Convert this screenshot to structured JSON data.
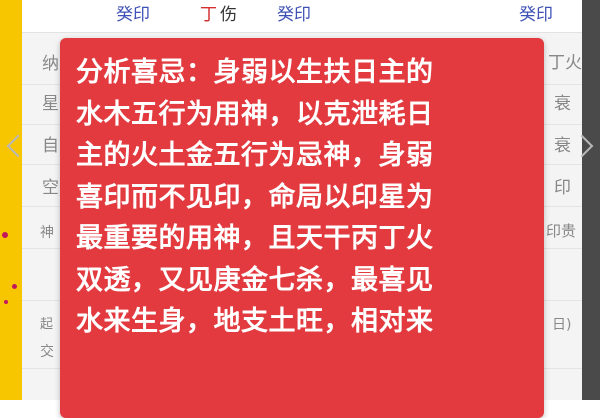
{
  "header_row": {
    "cells": [
      {
        "text": "癸印",
        "color": "#3f51b5"
      },
      {
        "text": "丁",
        "color": "#d32f2f"
      },
      {
        "text": "伤",
        "color": "#333333"
      },
      {
        "text": "癸印",
        "color": "#3f51b5"
      },
      {
        "text": "癸印",
        "color": "#3f51b5"
      }
    ]
  },
  "left_column": {
    "items": [
      "纳",
      "星",
      "自",
      "空",
      "神",
      "起",
      "交"
    ]
  },
  "right_column": {
    "items": [
      "丁火",
      "衰",
      "衰",
      "印",
      "印贵",
      "日)"
    ]
  },
  "popup": {
    "lines": [
      "分析喜忌：身弱以生扶日主的",
      "水木五行为用神，以克泄耗日",
      "主的火土金五行为忌神，身弱",
      "喜印而不见印，命局以印星为",
      "最重要的用神，且天干丙丁火",
      "双透，又见庚金七杀，最喜见",
      "水来生身，地支土旺，相对来"
    ],
    "background": "#e23a3f",
    "text_color": "#ffffff"
  },
  "colors": {
    "side_accent": "#f7c600",
    "accent_blue": "#3f51b5",
    "accent_red": "#d32f2f"
  },
  "icons": {
    "left_nav": "chevron-left-icon",
    "right_nav": "chevron-right-icon"
  }
}
